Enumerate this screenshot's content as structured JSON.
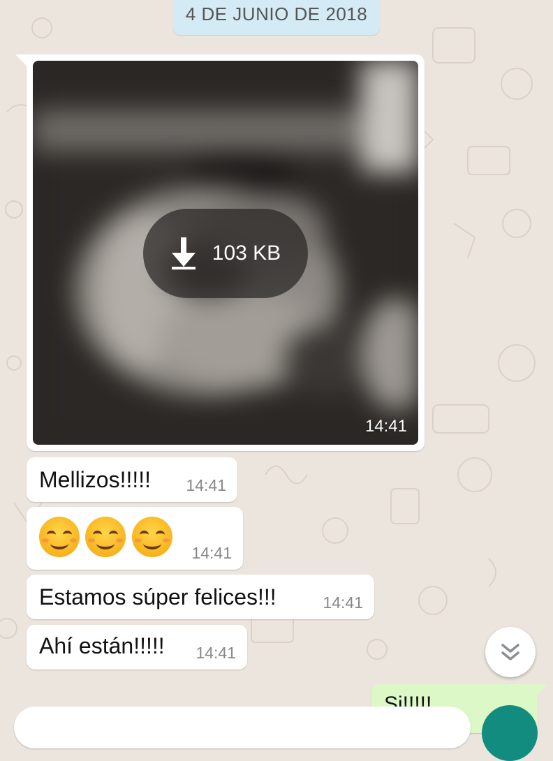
{
  "date_label": "4 DE JUNIO DE 2018",
  "image_message": {
    "download_size": "103 KB",
    "time": "14:41"
  },
  "messages": [
    {
      "text": "Mellizos!!!!!",
      "time": "14:41"
    },
    {
      "emoji_count": 3,
      "emoji": "smiling-face-with-smiling-eyes",
      "time": "14:41"
    },
    {
      "text": "Estamos súper felices!!!",
      "time": "14:41"
    },
    {
      "text": "Ahí están!!!!!",
      "time": "14:41"
    }
  ],
  "outgoing_partial": {
    "text": "Si!!!!!"
  },
  "colors": {
    "background": "#ece5dd",
    "date_pill": "#d4eaf4",
    "outgoing_bubble": "#dcf8c6",
    "accent": "#128c7e"
  },
  "icons": {
    "download": "download-arrow-icon",
    "scroll_down": "double-chevron-down-icon"
  }
}
